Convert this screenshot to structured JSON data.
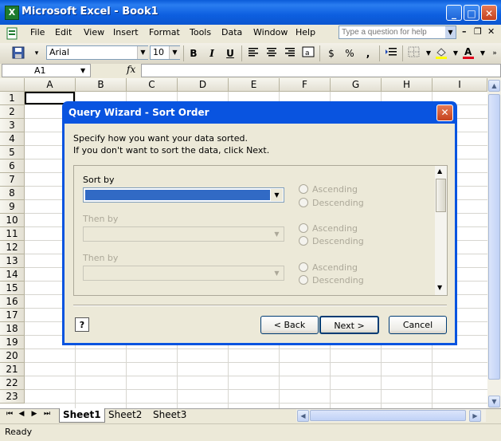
{
  "window": {
    "title": "Microsoft Excel - Book1",
    "controls": {
      "minimize": "_",
      "maximize": "□",
      "close": "✕"
    },
    "icon": "X"
  },
  "menubar": {
    "items": [
      "File",
      "Edit",
      "View",
      "Insert",
      "Format",
      "Tools",
      "Data",
      "Window",
      "Help"
    ],
    "help_placeholder": "Type a question for help"
  },
  "toolbar": {
    "font_name": "Arial",
    "font_size": "10",
    "bold_label": "B",
    "italic_label": "I",
    "underline_label": "U",
    "currency_label": "$",
    "percent_label": "%",
    "comma_label": ","
  },
  "formula_bar": {
    "name_box": "A1",
    "fx_label": "fx",
    "value": ""
  },
  "grid": {
    "columns": [
      "A",
      "B",
      "C",
      "D",
      "E",
      "F",
      "G",
      "H",
      "I"
    ],
    "rows": [
      "1",
      "2",
      "3",
      "4",
      "5",
      "6",
      "7",
      "8",
      "9",
      "10",
      "11",
      "12",
      "13",
      "14",
      "15",
      "16",
      "17",
      "18",
      "19",
      "20",
      "21",
      "22",
      "23"
    ]
  },
  "sheets": {
    "tabs": [
      "Sheet1",
      "Sheet2",
      "Sheet3"
    ],
    "active": "Sheet1"
  },
  "status": {
    "text": "Ready"
  },
  "dialog": {
    "title": "Query Wizard - Sort Order",
    "instruction_line1": "Specify how you want your data sorted.",
    "instruction_line2": "If you don't want to sort the data, click Next.",
    "sort_by_label": "Sort by",
    "then_by_label_1": "Then by",
    "then_by_label_2": "Then by",
    "ascending_label": "Ascending",
    "descending_label": "Descending",
    "back_label": "< Back",
    "next_label": "Next >",
    "cancel_label": "Cancel",
    "help_label": "?"
  }
}
